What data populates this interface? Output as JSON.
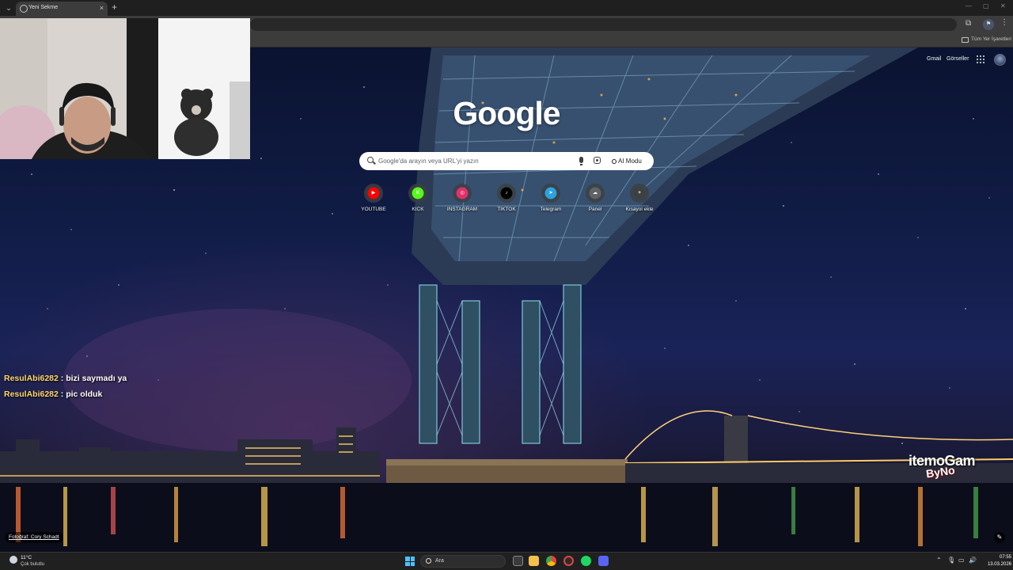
{
  "browser": {
    "tab_title": "Yeni Sekme",
    "new_tab_symbol": "+",
    "close_symbol": "×",
    "bookmarks_all_label": "Tüm Yer İşaretleri"
  },
  "ntp": {
    "top_links": {
      "gmail": "Gmail",
      "images": "Görseller"
    },
    "logo": "Google",
    "search_placeholder": "Google'da arayın veya URL'yi yazın",
    "ai_mode_label": "AI Modu",
    "shortcuts": [
      {
        "label": "YOUTUBE",
        "glyph": "▶",
        "color": "#ff0000"
      },
      {
        "label": "KICK",
        "glyph": "K",
        "color": "#53fc18"
      },
      {
        "label": "INSTAGRAM",
        "glyph": "◎",
        "color": "#e1306c"
      },
      {
        "label": "TIKTOK",
        "glyph": "♪",
        "color": "#000000"
      },
      {
        "label": "Telegram",
        "glyph": "➤",
        "color": "#2aa3df"
      },
      {
        "label": "Panel",
        "glyph": "☁",
        "color": "#5f6368"
      },
      {
        "label": "Kısayol ekle",
        "glyph": "+",
        "color": "#3c4043"
      }
    ],
    "photo_credit": "Fotoğraf: Cory Schadt"
  },
  "overlay": {
    "chat": [
      {
        "user": "ResulAbi6282",
        "message": ": bizi saymadı ya"
      },
      {
        "user": "ResulAbi6282",
        "message": ": pic olduk"
      }
    ],
    "watermark": "itemoGam",
    "watermark_sub": "ByNo"
  },
  "taskbar": {
    "weather_temp": "11°C",
    "weather_desc": "Çok bulutlu",
    "search_label": "Ara",
    "time": "07:55",
    "date": "13.03.2026"
  },
  "colors": {
    "accent": "#4cc2ff",
    "chat_user": "#ffd66b"
  }
}
